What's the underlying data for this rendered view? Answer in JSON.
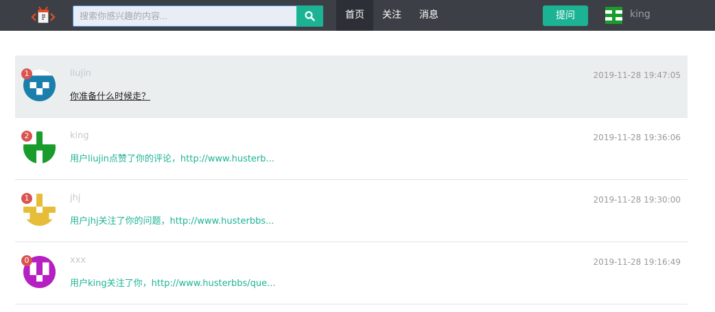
{
  "navbar": {
    "search_placeholder": "搜索你感兴趣的内容...",
    "nav_home": "首页",
    "nav_follow": "关注",
    "nav_messages": "消息",
    "ask_button": "提问",
    "username": "king"
  },
  "colors": {
    "navbar_bg": "#3c4046",
    "accent": "#1bb394",
    "badge": "#d9534f"
  },
  "messages": [
    {
      "badge": "1",
      "user": "liujin",
      "text": "你准备什么时候走？",
      "time": "2019-11-28 19:47:05",
      "avatar_color": "#1b7fad",
      "icon": "identicon-avatar"
    },
    {
      "badge": "2",
      "user": "king",
      "text": "用户liujin点赞了你的评论，http://www.husterb...",
      "time": "2019-11-28 19:36:06",
      "avatar_color": "#1a9c2c",
      "icon": "identicon-avatar"
    },
    {
      "badge": "1",
      "user": "jhj",
      "text": "用户jhj关注了你的问题，http://www.husterbbs...",
      "time": "2019-11-28 19:30:00",
      "avatar_color": "#e6bd38",
      "icon": "identicon-avatar"
    },
    {
      "badge": "0",
      "user": "xxx",
      "text": "用户king关注了你，http://www.husterbbs/que...",
      "time": "2019-11-28 19:16:49",
      "avatar_color": "#b61fc2",
      "icon": "identicon-avatar"
    }
  ]
}
